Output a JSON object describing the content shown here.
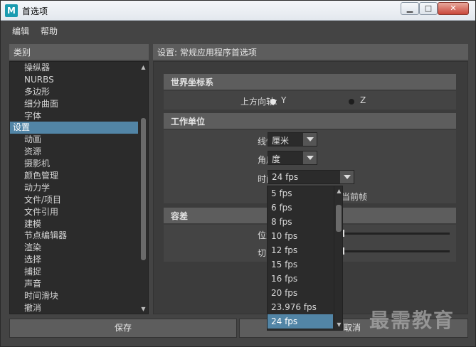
{
  "window": {
    "title": "首选项",
    "app_icon_letter": "M"
  },
  "menu": [
    "编辑",
    "帮助"
  ],
  "categories": {
    "header": "类别",
    "items": [
      {
        "label": "操纵器",
        "level": 1
      },
      {
        "label": "NURBS",
        "level": 1
      },
      {
        "label": "多边形",
        "level": 1
      },
      {
        "label": "细分曲面",
        "level": 1
      },
      {
        "label": "字体",
        "level": 1
      },
      {
        "label": "设置",
        "level": 0,
        "selected": true
      },
      {
        "label": "动画",
        "level": 1
      },
      {
        "label": "资源",
        "level": 1
      },
      {
        "label": "摄影机",
        "level": 1
      },
      {
        "label": "颜色管理",
        "level": 1
      },
      {
        "label": "动力学",
        "level": 1
      },
      {
        "label": "文件/项目",
        "level": 1
      },
      {
        "label": "文件引用",
        "level": 1
      },
      {
        "label": "建模",
        "level": 1
      },
      {
        "label": "节点编辑器",
        "level": 1
      },
      {
        "label": "渲染",
        "level": 1
      },
      {
        "label": "选择",
        "level": 1
      },
      {
        "label": "捕捉",
        "level": 1
      },
      {
        "label": "声音",
        "level": 1
      },
      {
        "label": "时间滑块",
        "level": 1
      },
      {
        "label": "撤消",
        "level": 1
      }
    ]
  },
  "settings": {
    "header": "设置: 常规应用程序首选项",
    "world": {
      "title": "世界坐标系",
      "up_axis_label": "上方向轴:",
      "option_y": "Y",
      "option_z": "Z",
      "selected": "Y"
    },
    "units": {
      "title": "工作单位",
      "linear_label": "线性:",
      "linear_value": "厘米",
      "angular_label": "角度:",
      "angular_value": "度",
      "time_label": "时间:",
      "time_value": "24 fps",
      "partial_text": "当前帧"
    },
    "tolerance": {
      "title": "容差",
      "position_label": "位置:",
      "tangent_label": "切向:"
    }
  },
  "time_dropdown": {
    "options": [
      "5 fps",
      "6 fps",
      "8 fps",
      "10 fps",
      "12 fps",
      "15 fps",
      "16 fps",
      "20 fps",
      "23.976 fps",
      "24 fps"
    ],
    "selected": "24 fps"
  },
  "buttons": {
    "save": "保存",
    "cancel": "取消"
  },
  "watermark": "最需教育"
}
